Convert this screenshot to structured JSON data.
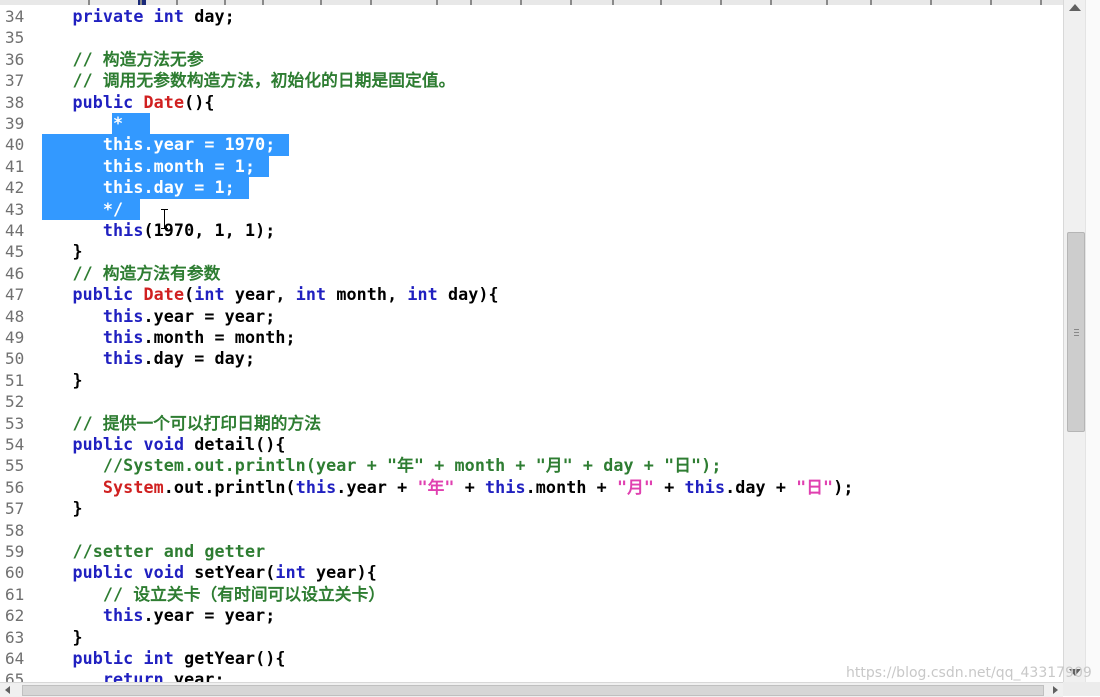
{
  "editor": {
    "language": "java",
    "selection": {
      "first_line": 39,
      "last_line": 43
    },
    "lines": [
      {
        "n": "34",
        "tokens": [
          [
            "",
            "   "
          ],
          [
            "kw",
            "private"
          ],
          [
            "",
            " "
          ],
          [
            "kw",
            "int"
          ],
          [
            "",
            " day;"
          ]
        ]
      },
      {
        "n": "35",
        "tokens": []
      },
      {
        "n": "36",
        "tokens": [
          [
            "",
            "   "
          ],
          [
            "cm",
            "// 构造方法无参"
          ]
        ]
      },
      {
        "n": "37",
        "tokens": [
          [
            "",
            "   "
          ],
          [
            "cm",
            "// 调用无参数构造方法，初始化的日期是固定值。"
          ]
        ]
      },
      {
        "n": "38",
        "tokens": [
          [
            "",
            "   "
          ],
          [
            "kw",
            "public"
          ],
          [
            "",
            " "
          ],
          [
            "cls",
            "Date"
          ],
          [
            "",
            "(){"
          ]
        ]
      },
      {
        "n": "39",
        "tokens": [
          [
            "",
            "      "
          ],
          [
            "selt",
            "/*"
          ]
        ]
      },
      {
        "n": "40",
        "tokens": [
          [
            "",
            "      "
          ],
          [
            "selt",
            "this.year = 1970;"
          ]
        ]
      },
      {
        "n": "41",
        "tokens": [
          [
            "",
            "      "
          ],
          [
            "selt",
            "this.month = 1;"
          ]
        ]
      },
      {
        "n": "42",
        "tokens": [
          [
            "",
            "      "
          ],
          [
            "selt",
            "this.day = 1;"
          ]
        ]
      },
      {
        "n": "43",
        "tokens": [
          [
            "",
            "      "
          ],
          [
            "selt",
            "*/"
          ]
        ]
      },
      {
        "n": "44",
        "tokens": [
          [
            "",
            "      "
          ],
          [
            "kw",
            "this"
          ],
          [
            "",
            "(1970, 1, 1);"
          ]
        ]
      },
      {
        "n": "45",
        "tokens": [
          [
            "",
            "   }"
          ]
        ]
      },
      {
        "n": "46",
        "tokens": [
          [
            "",
            "   "
          ],
          [
            "cm",
            "// 构造方法有参数"
          ]
        ]
      },
      {
        "n": "47",
        "tokens": [
          [
            "",
            "   "
          ],
          [
            "kw",
            "public"
          ],
          [
            "",
            " "
          ],
          [
            "cls",
            "Date"
          ],
          [
            "",
            "("
          ],
          [
            "kw",
            "int"
          ],
          [
            "",
            " year, "
          ],
          [
            "kw",
            "int"
          ],
          [
            "",
            " month, "
          ],
          [
            "kw",
            "int"
          ],
          [
            "",
            " day){"
          ]
        ]
      },
      {
        "n": "48",
        "tokens": [
          [
            "",
            "      "
          ],
          [
            "kw",
            "this"
          ],
          [
            "",
            ".year = year;"
          ]
        ]
      },
      {
        "n": "49",
        "tokens": [
          [
            "",
            "      "
          ],
          [
            "kw",
            "this"
          ],
          [
            "",
            ".month = month;"
          ]
        ]
      },
      {
        "n": "50",
        "tokens": [
          [
            "",
            "      "
          ],
          [
            "kw",
            "this"
          ],
          [
            "",
            ".day = day;"
          ]
        ]
      },
      {
        "n": "51",
        "tokens": [
          [
            "",
            "   }"
          ]
        ]
      },
      {
        "n": "52",
        "tokens": []
      },
      {
        "n": "53",
        "tokens": [
          [
            "",
            "   "
          ],
          [
            "cm",
            "// 提供一个可以打印日期的方法"
          ]
        ]
      },
      {
        "n": "54",
        "tokens": [
          [
            "",
            "   "
          ],
          [
            "kw",
            "public"
          ],
          [
            "",
            " "
          ],
          [
            "kw",
            "void"
          ],
          [
            "",
            " detail(){"
          ]
        ]
      },
      {
        "n": "55",
        "tokens": [
          [
            "",
            "      "
          ],
          [
            "cm",
            "//System.out.println(year + \"年\" + month + \"月\" + day + \"日\");"
          ]
        ]
      },
      {
        "n": "56",
        "tokens": [
          [
            "",
            "      "
          ],
          [
            "cls",
            "System"
          ],
          [
            "",
            ".out.println("
          ],
          [
            "kw",
            "this"
          ],
          [
            "",
            ".year + "
          ],
          [
            "str",
            "\"年\""
          ],
          [
            "",
            " + "
          ],
          [
            "kw",
            "this"
          ],
          [
            "",
            ".month + "
          ],
          [
            "str",
            "\"月\""
          ],
          [
            "",
            " + "
          ],
          [
            "kw",
            "this"
          ],
          [
            "",
            ".day + "
          ],
          [
            "str",
            "\"日\""
          ],
          [
            "",
            ");"
          ]
        ]
      },
      {
        "n": "57",
        "tokens": [
          [
            "",
            "   }"
          ]
        ]
      },
      {
        "n": "58",
        "tokens": []
      },
      {
        "n": "59",
        "tokens": [
          [
            "",
            "   "
          ],
          [
            "cm",
            "//setter and getter"
          ]
        ]
      },
      {
        "n": "60",
        "tokens": [
          [
            "",
            "   "
          ],
          [
            "kw",
            "public"
          ],
          [
            "",
            " "
          ],
          [
            "kw",
            "void"
          ],
          [
            "",
            " setYear("
          ],
          [
            "kw",
            "int"
          ],
          [
            "",
            " year){"
          ]
        ]
      },
      {
        "n": "61",
        "tokens": [
          [
            "",
            "      "
          ],
          [
            "cm",
            "// 设立关卡（有时间可以设立关卡）"
          ]
        ]
      },
      {
        "n": "62",
        "tokens": [
          [
            "",
            "      "
          ],
          [
            "kw",
            "this"
          ],
          [
            "",
            ".year = year;"
          ]
        ]
      },
      {
        "n": "63",
        "tokens": [
          [
            "",
            "   }"
          ]
        ]
      },
      {
        "n": "64",
        "tokens": [
          [
            "",
            "   "
          ],
          [
            "kw",
            "public"
          ],
          [
            "",
            " "
          ],
          [
            "kw",
            "int"
          ],
          [
            "",
            " getYear(){"
          ]
        ]
      },
      {
        "n": "65",
        "tokens": [
          [
            "",
            "      "
          ],
          [
            "kw",
            "return"
          ],
          [
            "",
            " year;"
          ]
        ]
      }
    ]
  },
  "watermark": "https://blog.csdn.net/qq_43317909",
  "colors": {
    "keyword": "#2020c0",
    "comment": "#2e7d32",
    "string": "#e040b0",
    "class": "#d02020",
    "selection": "#3399ff"
  }
}
